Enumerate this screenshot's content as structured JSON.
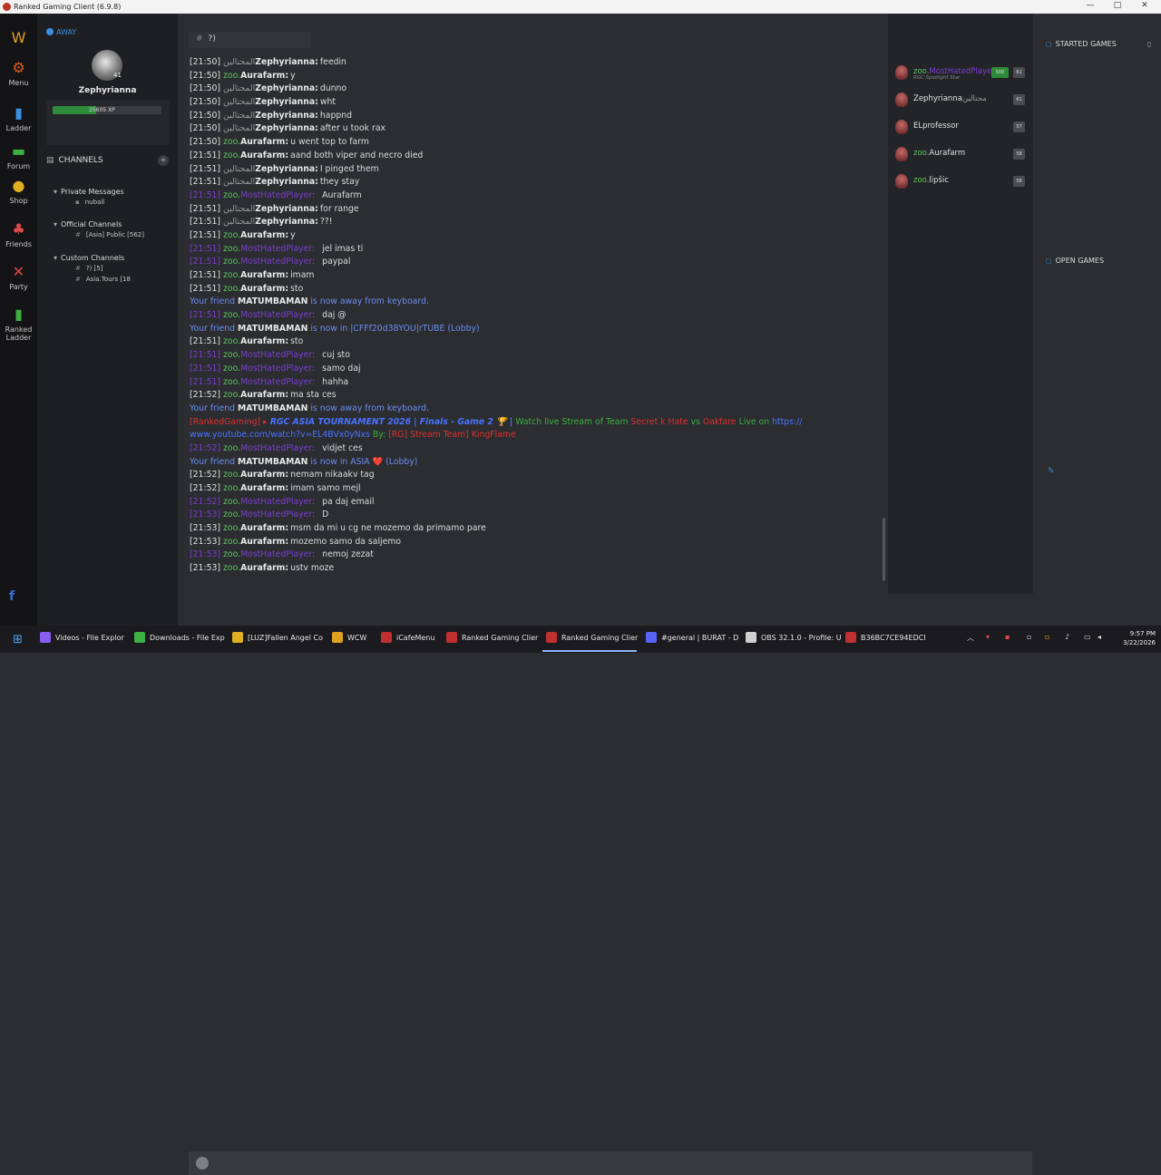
{
  "window": {
    "title": "Ranked Gaming Client (6.9.8)",
    "minimize": "—",
    "maximize": "□",
    "close": "✕"
  },
  "rail": [
    {
      "label": "",
      "icon": "W",
      "color": "#e0a020"
    },
    {
      "label": "Menu",
      "icon": "⚙",
      "color": "#e05a20"
    },
    {
      "label": "Ladder",
      "icon": "▮",
      "color": "#3b8fe0"
    },
    {
      "label": "Forum",
      "icon": "▬",
      "color": "#3db043"
    },
    {
      "label": "Shop",
      "icon": "●",
      "color": "#e0b020"
    },
    {
      "label": "Friends",
      "icon": "♣",
      "color": "#e04a4a"
    },
    {
      "label": "Party",
      "icon": "✕",
      "color": "#e04a4a"
    },
    {
      "label": "Ranked Ladder",
      "icon": "▮",
      "color": "#3db043"
    }
  ],
  "profile": {
    "status": "AWAY",
    "username": "Zephyrianna",
    "level": "41",
    "xp_text": "25605 XP",
    "xp_fraction": 0.4
  },
  "channels": {
    "header": "CHANNELS",
    "private_group": "Private Messages",
    "private_item": "nuball",
    "official_group": "Official Channels",
    "official_item": "[Asia] Public [562]",
    "custom_group": "Custom Channels",
    "custom_item_1": "?) [5]",
    "custom_item_2": "Asia.Tours [18"
  },
  "chat_header": "?)",
  "messages": [
    {
      "type": "chat",
      "ts": "[21:50]",
      "prefix": "المحتالين",
      "prefix_style": "ar",
      "name": "Zephyrianna:",
      "text": "feedin"
    },
    {
      "type": "chat",
      "ts": "[21:50]",
      "prefix": "zoo.",
      "prefix_style": "green",
      "name": "Aurafarm:",
      "text": "y"
    },
    {
      "type": "chat",
      "ts": "[21:50]",
      "prefix": "المحتالين",
      "prefix_style": "ar",
      "name": "Zephyrianna:",
      "text": "dunno"
    },
    {
      "type": "chat",
      "ts": "[21:50]",
      "prefix": "المحتالين",
      "prefix_style": "ar",
      "name": "Zephyrianna:",
      "text": "wht"
    },
    {
      "type": "chat",
      "ts": "[21:50]",
      "prefix": "المحتالين",
      "prefix_style": "ar",
      "name": "Zephyrianna:",
      "text": "happnd"
    },
    {
      "type": "chat",
      "ts": "[21:50]",
      "prefix": "المحتالين",
      "prefix_style": "ar",
      "name": "Zephyrianna:",
      "text": "after u took rax"
    },
    {
      "type": "chat",
      "ts": "[21:50]",
      "prefix": "zoo.",
      "prefix_style": "green",
      "name": "Aurafarm:",
      "text": "u went top to farm"
    },
    {
      "type": "chat",
      "ts": "[21:51]",
      "prefix": "zoo.",
      "prefix_style": "green",
      "name": "Aurafarm:",
      "text": "aand both viper and necro died"
    },
    {
      "type": "chat",
      "ts": "[21:51]",
      "prefix": "المحتالين",
      "prefix_style": "ar",
      "name": "Zephyrianna:",
      "text": "I pinged them"
    },
    {
      "type": "chat",
      "ts": "[21:51]",
      "prefix": "المحتالين",
      "prefix_style": "ar",
      "name": "Zephyrianna:",
      "text": "they stay"
    },
    {
      "type": "hated",
      "ts": "[21:51]",
      "prefix": "zoo.",
      "name": "MostHatedPlayer:",
      "text": "Aurafarm"
    },
    {
      "type": "chat",
      "ts": "[21:51]",
      "prefix": "المحتالين",
      "prefix_style": "ar",
      "name": "Zephyrianna:",
      "text": "for range"
    },
    {
      "type": "chat",
      "ts": "[21:51]",
      "prefix": "المحتالين",
      "prefix_style": "ar",
      "name": "Zephyrianna:",
      "text": "??!"
    },
    {
      "type": "chat",
      "ts": "[21:51]",
      "prefix": "zoo.",
      "prefix_style": "green",
      "name": "Aurafarm:",
      "text": "y"
    },
    {
      "type": "hated",
      "ts": "[21:51]",
      "prefix": "zoo.",
      "name": "MostHatedPlayer:",
      "text": "jel imas ti"
    },
    {
      "type": "hated",
      "ts": "[21:51]",
      "prefix": "zoo.",
      "name": "MostHatedPlayer:",
      "text": "paypal"
    },
    {
      "type": "chat",
      "ts": "[21:51]",
      "prefix": "zoo.",
      "prefix_style": "green",
      "name": "Aurafarm:",
      "text": "imam"
    },
    {
      "type": "chat",
      "ts": "[21:51]",
      "prefix": "zoo.",
      "prefix_style": "green",
      "name": "Aurafarm:",
      "text": "sto"
    },
    {
      "type": "system",
      "pre": "Your friend",
      "name": "MATUMBAMAN",
      "post": "is now away from keyboard."
    },
    {
      "type": "hated",
      "ts": "[21:51]",
      "prefix": "zoo.",
      "name": "MostHatedPlayer:",
      "text": "daj @"
    },
    {
      "type": "system",
      "pre": "Your friend",
      "name": "MATUMBAMAN",
      "post": "is now in |CFFf20d38YOU|rTUBE (Lobby)"
    },
    {
      "type": "chat",
      "ts": "[21:51]",
      "prefix": "zoo.",
      "prefix_style": "green",
      "name": "Aurafarm:",
      "text": "sto"
    },
    {
      "type": "hated",
      "ts": "[21:51]",
      "prefix": "zoo.",
      "name": "MostHatedPlayer:",
      "text": "cuj sto"
    },
    {
      "type": "hated",
      "ts": "[21:51]",
      "prefix": "zoo.",
      "name": "MostHatedPlayer:",
      "text": "samo daj"
    },
    {
      "type": "hated",
      "ts": "[21:51]",
      "prefix": "zoo.",
      "name": "MostHatedPlayer:",
      "text": "hahha"
    },
    {
      "type": "chat",
      "ts": "[21:52]",
      "prefix": "zoo.",
      "prefix_style": "green",
      "name": "Aurafarm:",
      "text": "ma sta ces"
    },
    {
      "type": "system",
      "pre": "Your friend",
      "name": "MATUMBAMAN",
      "post": "is now away from keyboard."
    },
    {
      "type": "broadcast",
      "a": "[RankedGaming] ▸",
      "b": "RGC ASIA TOURNAMENT 2026",
      "c": "| Finals - Game 2 🏆 |",
      "d": "Watch live Stream of Team",
      "e": "Secret k Hate",
      "f": "vs",
      "g": "Oakfare",
      "h": "Live on",
      "link": "https://"
    },
    {
      "type": "broadcast2",
      "link": "www.youtube.com/watch?v=EL4BVx0yNxs",
      "by": "By:",
      "who": "[RG] Stream Team] KingFlame"
    },
    {
      "type": "hated",
      "ts": "[21:52]",
      "prefix": "zoo.",
      "name": "MostHatedPlayer:",
      "text": "vidjet ces"
    },
    {
      "type": "system",
      "pre": "Your friend",
      "name": "MATUMBAMAN",
      "post": "is now in ASIA ❤️ (Lobby)"
    },
    {
      "type": "chat",
      "ts": "[21:52]",
      "prefix": "zoo.",
      "prefix_style": "green",
      "name": "Aurafarm:",
      "text": "nemam nikaakv tag"
    },
    {
      "type": "chat",
      "ts": "[21:52]",
      "prefix": "zoo.",
      "prefix_style": "green",
      "name": "Aurafarm:",
      "text": "imam samo mejl"
    },
    {
      "type": "hated",
      "ts": "[21:52]",
      "prefix": "zoo.",
      "name": "MostHatedPlayer:",
      "text": "pa daj email"
    },
    {
      "type": "hated",
      "ts": "[21:53]",
      "prefix": "zoo.",
      "name": "MostHatedPlayer:",
      "text": "D"
    },
    {
      "type": "chat",
      "ts": "[21:53]",
      "prefix": "zoo.",
      "prefix_style": "green",
      "name": "Aurafarm:",
      "text": "msm da mi u cg ne mozemo da primamo pare"
    },
    {
      "type": "chat",
      "ts": "[21:53]",
      "prefix": "zoo.",
      "prefix_style": "green",
      "name": "Aurafarm:",
      "text": "mozemo samo da saljemo"
    },
    {
      "type": "hated",
      "ts": "[21:53]",
      "prefix": "zoo.",
      "name": "MostHatedPlayer:",
      "text": "nemoj zezat"
    },
    {
      "type": "chat",
      "ts": "[21:53]",
      "prefix": "zoo.",
      "prefix_style": "green",
      "name": "Aurafarm:",
      "text": "ustv moze"
    }
  ],
  "users": [
    {
      "prefix": "zoo.",
      "name": "MostHatedPlayer",
      "sub": "RGC Spotlight Star",
      "badge1": "500",
      "badge2": "61",
      "name_color": "#7b3dd1"
    },
    {
      "prefix": "",
      "name": "Zephyrianna",
      "suffix": "محتالين",
      "sub": "",
      "badge1": "",
      "badge2": "61",
      "name_color": "#e0e0e0"
    },
    {
      "prefix": "",
      "name": "ELprofessor",
      "sub": "",
      "badge1": "",
      "badge2": "57",
      "name_color": "#e0e0e0"
    },
    {
      "prefix": "zoo.",
      "name": "Aurafarm",
      "sub": "",
      "badge1": "",
      "badge2": "58",
      "name_color": "#e0e0e0"
    },
    {
      "prefix": "zoo.",
      "name": "lipšic",
      "sub": "",
      "badge1": "",
      "badge2": "58",
      "name_color": "#e0e0e0"
    }
  ],
  "games": {
    "started": "STARTED GAMES",
    "open": "OPEN GAMES"
  },
  "taskbar": [
    {
      "label": "Videos - File Explor",
      "color": "#8a5cf0"
    },
    {
      "label": "Downloads - File Exp",
      "color": "#3db043"
    },
    {
      "label": "[LUZ]Fallen Angel Co",
      "color": "#e0b020"
    },
    {
      "label": "WCW",
      "color": "#e0a020"
    },
    {
      "label": "iCafeMenu",
      "color": "#c03030"
    },
    {
      "label": "Ranked Gaming Clier",
      "color": "#c03030"
    },
    {
      "label": "Ranked Gaming Clier",
      "color": "#c03030"
    },
    {
      "label": "#general | BURAT - D",
      "color": "#5865f2"
    },
    {
      "label": "OBS 32.1.0 - Profile: U",
      "color": "#d0d0d0"
    },
    {
      "label": "B36BC7CE94EDCI",
      "color": "#c03030"
    }
  ],
  "clock": {
    "time": "9:57 PM",
    "date": "3/22/2026"
  }
}
